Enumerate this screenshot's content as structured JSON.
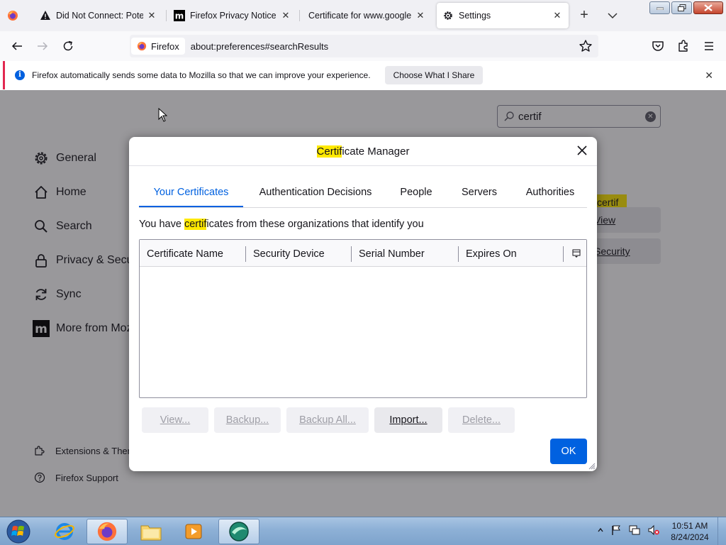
{
  "browser": {
    "tabs": [
      {
        "title": "Did Not Connect: Potential Security Issue",
        "icon": "warning-icon"
      },
      {
        "title": "Firefox Privacy Notice — Mozilla",
        "icon": "mozilla-m-icon"
      },
      {
        "title": "Certificate for www.google.com",
        "icon": "none"
      },
      {
        "title": "Settings",
        "icon": "gear-icon"
      }
    ],
    "identity_label": "Firefox",
    "url": "about:preferences#searchResults"
  },
  "notification": {
    "text": "Firefox automatically sends some data to Mozilla so that we can improve your experience.",
    "button": "Choose What I Share"
  },
  "preferences": {
    "search_value": "certif",
    "categories": [
      {
        "label": "General",
        "icon": "gear-icon"
      },
      {
        "label": "Home",
        "icon": "home-icon"
      },
      {
        "label": "Search",
        "icon": "search-icon"
      },
      {
        "label": "Privacy & Security",
        "icon": "lock-icon"
      },
      {
        "label": "Sync",
        "icon": "sync-icon"
      },
      {
        "label": "More from Mozilla",
        "icon": "mozilla-m-icon"
      }
    ],
    "footer": [
      {
        "label": "Extensions & Themes",
        "icon": "puzzle-icon"
      },
      {
        "label": "Firefox Support",
        "icon": "help-icon"
      }
    ],
    "highlight_text": "certif",
    "view_certificates": "View Certificates...",
    "security_devices": "Security Devices..."
  },
  "dialog": {
    "title_highlight": "Certif",
    "title_rest": "icate Manager",
    "tabs": [
      "Your Certificates",
      "Authentication Decisions",
      "People",
      "Servers",
      "Authorities"
    ],
    "active_tab": "Your Certificates",
    "desc_before": "You have ",
    "desc_highlight": "certif",
    "desc_after": "icates from these organizations that identify you",
    "columns": [
      "Certificate Name",
      "Security Device",
      "Serial Number",
      "Expires On"
    ],
    "rows": [],
    "buttons": {
      "view": "View...",
      "backup": "Backup...",
      "backup_all": "Backup All...",
      "import": "Import...",
      "delete": "Delete..."
    },
    "ok": "OK"
  },
  "taskbar": {
    "time": "10:51 AM",
    "date": "8/24/2024"
  },
  "colors": {
    "accent": "#0061e0",
    "highlight": "#ffe900",
    "notification_border": "#e22850"
  }
}
